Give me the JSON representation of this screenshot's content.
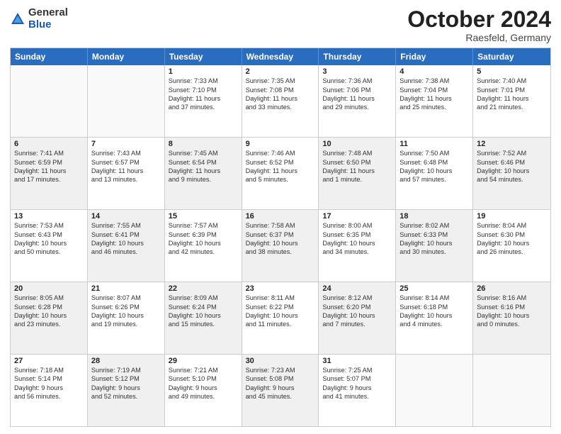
{
  "logo": {
    "general": "General",
    "blue": "Blue"
  },
  "title": "October 2024",
  "location": "Raesfeld, Germany",
  "header_days": [
    "Sunday",
    "Monday",
    "Tuesday",
    "Wednesday",
    "Thursday",
    "Friday",
    "Saturday"
  ],
  "rows": [
    [
      {
        "day": "",
        "lines": [],
        "empty": true
      },
      {
        "day": "",
        "lines": [],
        "empty": true
      },
      {
        "day": "1",
        "lines": [
          "Sunrise: 7:33 AM",
          "Sunset: 7:10 PM",
          "Daylight: 11 hours",
          "and 37 minutes."
        ]
      },
      {
        "day": "2",
        "lines": [
          "Sunrise: 7:35 AM",
          "Sunset: 7:08 PM",
          "Daylight: 11 hours",
          "and 33 minutes."
        ]
      },
      {
        "day": "3",
        "lines": [
          "Sunrise: 7:36 AM",
          "Sunset: 7:06 PM",
          "Daylight: 11 hours",
          "and 29 minutes."
        ]
      },
      {
        "day": "4",
        "lines": [
          "Sunrise: 7:38 AM",
          "Sunset: 7:04 PM",
          "Daylight: 11 hours",
          "and 25 minutes."
        ]
      },
      {
        "day": "5",
        "lines": [
          "Sunrise: 7:40 AM",
          "Sunset: 7:01 PM",
          "Daylight: 11 hours",
          "and 21 minutes."
        ]
      }
    ],
    [
      {
        "day": "6",
        "lines": [
          "Sunrise: 7:41 AM",
          "Sunset: 6:59 PM",
          "Daylight: 11 hours",
          "and 17 minutes."
        ],
        "shaded": true
      },
      {
        "day": "7",
        "lines": [
          "Sunrise: 7:43 AM",
          "Sunset: 6:57 PM",
          "Daylight: 11 hours",
          "and 13 minutes."
        ]
      },
      {
        "day": "8",
        "lines": [
          "Sunrise: 7:45 AM",
          "Sunset: 6:54 PM",
          "Daylight: 11 hours",
          "and 9 minutes."
        ],
        "shaded": true
      },
      {
        "day": "9",
        "lines": [
          "Sunrise: 7:46 AM",
          "Sunset: 6:52 PM",
          "Daylight: 11 hours",
          "and 5 minutes."
        ]
      },
      {
        "day": "10",
        "lines": [
          "Sunrise: 7:48 AM",
          "Sunset: 6:50 PM",
          "Daylight: 11 hours",
          "and 1 minute."
        ],
        "shaded": true
      },
      {
        "day": "11",
        "lines": [
          "Sunrise: 7:50 AM",
          "Sunset: 6:48 PM",
          "Daylight: 10 hours",
          "and 57 minutes."
        ]
      },
      {
        "day": "12",
        "lines": [
          "Sunrise: 7:52 AM",
          "Sunset: 6:46 PM",
          "Daylight: 10 hours",
          "and 54 minutes."
        ],
        "shaded": true
      }
    ],
    [
      {
        "day": "13",
        "lines": [
          "Sunrise: 7:53 AM",
          "Sunset: 6:43 PM",
          "Daylight: 10 hours",
          "and 50 minutes."
        ]
      },
      {
        "day": "14",
        "lines": [
          "Sunrise: 7:55 AM",
          "Sunset: 6:41 PM",
          "Daylight: 10 hours",
          "and 46 minutes."
        ],
        "shaded": true
      },
      {
        "day": "15",
        "lines": [
          "Sunrise: 7:57 AM",
          "Sunset: 6:39 PM",
          "Daylight: 10 hours",
          "and 42 minutes."
        ]
      },
      {
        "day": "16",
        "lines": [
          "Sunrise: 7:58 AM",
          "Sunset: 6:37 PM",
          "Daylight: 10 hours",
          "and 38 minutes."
        ],
        "shaded": true
      },
      {
        "day": "17",
        "lines": [
          "Sunrise: 8:00 AM",
          "Sunset: 6:35 PM",
          "Daylight: 10 hours",
          "and 34 minutes."
        ]
      },
      {
        "day": "18",
        "lines": [
          "Sunrise: 8:02 AM",
          "Sunset: 6:33 PM",
          "Daylight: 10 hours",
          "and 30 minutes."
        ],
        "shaded": true
      },
      {
        "day": "19",
        "lines": [
          "Sunrise: 8:04 AM",
          "Sunset: 6:30 PM",
          "Daylight: 10 hours",
          "and 26 minutes."
        ]
      }
    ],
    [
      {
        "day": "20",
        "lines": [
          "Sunrise: 8:05 AM",
          "Sunset: 6:28 PM",
          "Daylight: 10 hours",
          "and 23 minutes."
        ],
        "shaded": true
      },
      {
        "day": "21",
        "lines": [
          "Sunrise: 8:07 AM",
          "Sunset: 6:26 PM",
          "Daylight: 10 hours",
          "and 19 minutes."
        ]
      },
      {
        "day": "22",
        "lines": [
          "Sunrise: 8:09 AM",
          "Sunset: 6:24 PM",
          "Daylight: 10 hours",
          "and 15 minutes."
        ],
        "shaded": true
      },
      {
        "day": "23",
        "lines": [
          "Sunrise: 8:11 AM",
          "Sunset: 6:22 PM",
          "Daylight: 10 hours",
          "and 11 minutes."
        ]
      },
      {
        "day": "24",
        "lines": [
          "Sunrise: 8:12 AM",
          "Sunset: 6:20 PM",
          "Daylight: 10 hours",
          "and 7 minutes."
        ],
        "shaded": true
      },
      {
        "day": "25",
        "lines": [
          "Sunrise: 8:14 AM",
          "Sunset: 6:18 PM",
          "Daylight: 10 hours",
          "and 4 minutes."
        ]
      },
      {
        "day": "26",
        "lines": [
          "Sunrise: 8:16 AM",
          "Sunset: 6:16 PM",
          "Daylight: 10 hours",
          "and 0 minutes."
        ],
        "shaded": true
      }
    ],
    [
      {
        "day": "27",
        "lines": [
          "Sunrise: 7:18 AM",
          "Sunset: 5:14 PM",
          "Daylight: 9 hours",
          "and 56 minutes."
        ]
      },
      {
        "day": "28",
        "lines": [
          "Sunrise: 7:19 AM",
          "Sunset: 5:12 PM",
          "Daylight: 9 hours",
          "and 52 minutes."
        ],
        "shaded": true
      },
      {
        "day": "29",
        "lines": [
          "Sunrise: 7:21 AM",
          "Sunset: 5:10 PM",
          "Daylight: 9 hours",
          "and 49 minutes."
        ]
      },
      {
        "day": "30",
        "lines": [
          "Sunrise: 7:23 AM",
          "Sunset: 5:08 PM",
          "Daylight: 9 hours",
          "and 45 minutes."
        ],
        "shaded": true
      },
      {
        "day": "31",
        "lines": [
          "Sunrise: 7:25 AM",
          "Sunset: 5:07 PM",
          "Daylight: 9 hours",
          "and 41 minutes."
        ]
      },
      {
        "day": "",
        "lines": [],
        "empty": true
      },
      {
        "day": "",
        "lines": [],
        "empty": true
      }
    ]
  ]
}
